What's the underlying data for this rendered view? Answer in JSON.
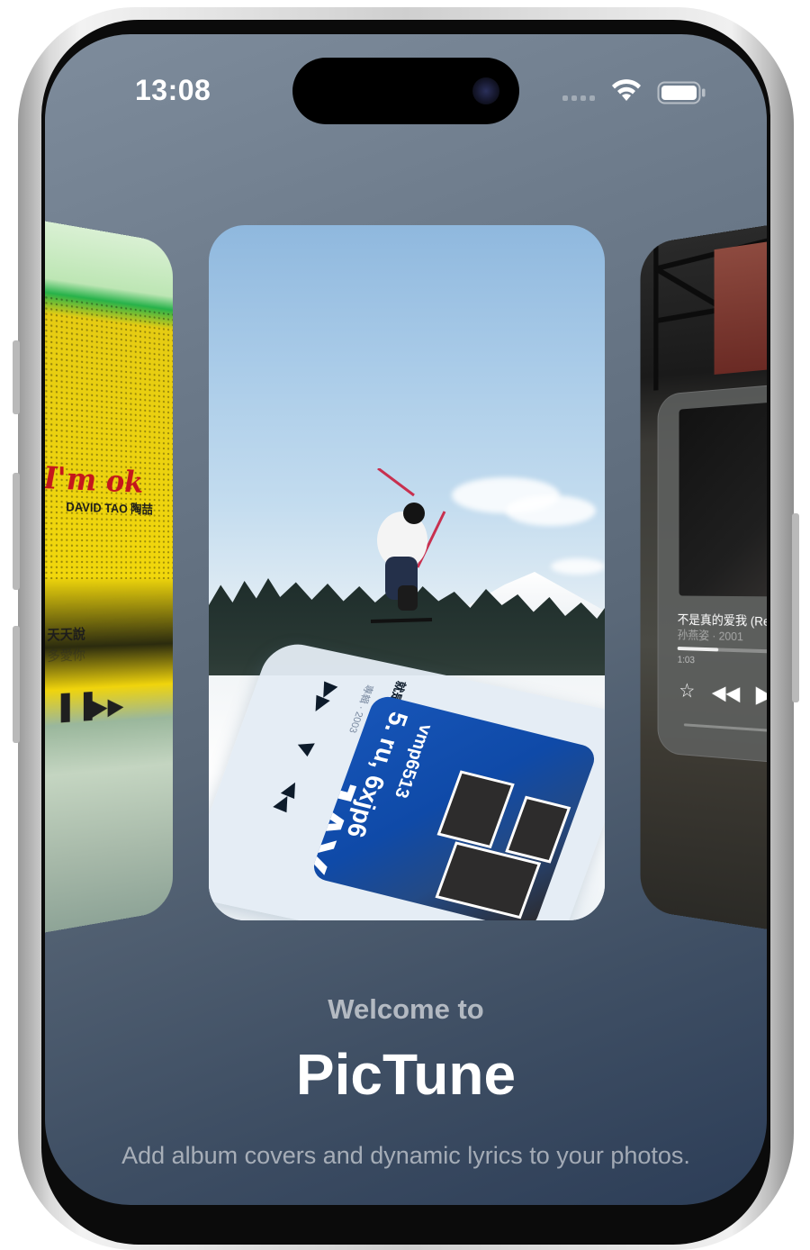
{
  "status_bar": {
    "time": "13:08",
    "icons": [
      "cellular-signal-icon",
      "wifi-icon",
      "battery-icon"
    ]
  },
  "carousel": {
    "left_card": {
      "logo_script": "I'm ok",
      "artist": "DAVID TAO 陶喆",
      "lyric_current": "天天說",
      "lyric_next": "多愛你"
    },
    "center_card": {
      "player_song": "就是",
      "player_meta": "專輯 · 2003",
      "cover_text_a": "5. ru, 6xjp6",
      "cover_text_b": "vmp6513",
      "cover_text_c": "JAY"
    },
    "right_card": {
      "song_title": "不是真的爱我 (Remastered)",
      "artist_year": "孙燕姿 · 2001",
      "elapsed": "1:03",
      "progress": 0.28
    }
  },
  "welcome": {
    "intro": "Welcome to",
    "app_name": "PicTune",
    "tagline": "Add album covers and dynamic lyrics to your photos."
  },
  "colors": {
    "screen_top": "#7e8c9c",
    "screen_bottom": "#2c3d57",
    "text_primary": "#ffffff"
  }
}
